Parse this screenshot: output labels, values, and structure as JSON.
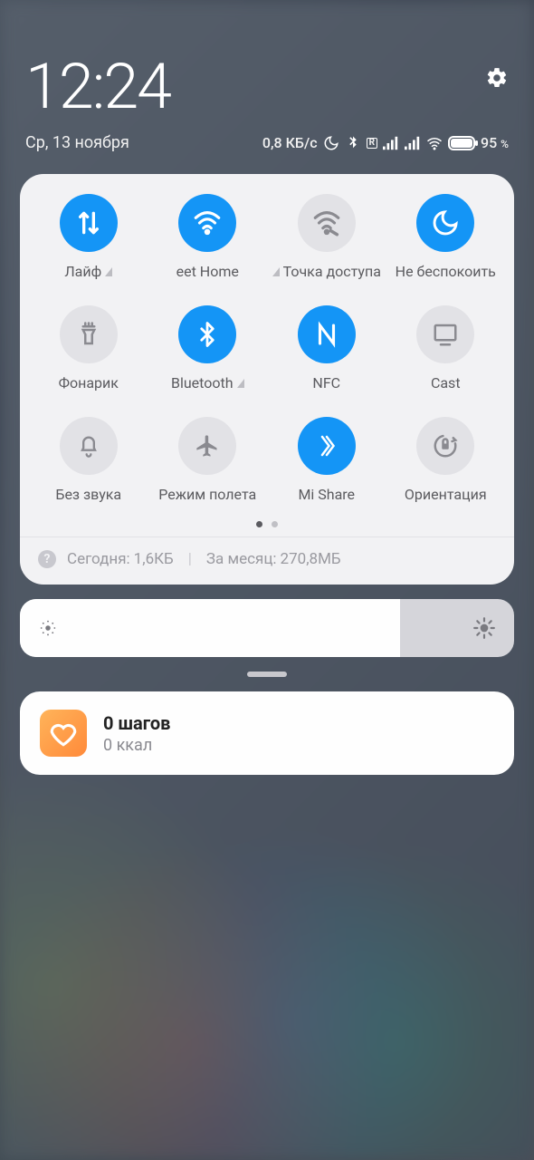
{
  "status": {
    "time": "12:24",
    "date": "Ср, 13 ноября",
    "data_rate": "0,8 КБ/с",
    "battery_pct": "95",
    "battery_suffix": "%"
  },
  "tiles": [
    {
      "label": "Лайф",
      "arrow": true
    },
    {
      "label": "eet Home",
      "arrow": false
    },
    {
      "label": "Точка доступа",
      "arrow": true,
      "arrow_before": true
    },
    {
      "label": "Не беспокоить",
      "arrow": false
    },
    {
      "label": "Фонарик",
      "arrow": false
    },
    {
      "label": "Bluetooth",
      "arrow": true
    },
    {
      "label": "NFC",
      "arrow": false
    },
    {
      "label": "Cast",
      "arrow": false
    },
    {
      "label": "Без звука",
      "arrow": false
    },
    {
      "label": "Режим полета",
      "arrow": false
    },
    {
      "label": "Mi Share",
      "arrow": false
    },
    {
      "label": "Ориентация",
      "arrow": false
    }
  ],
  "data_usage": {
    "today_label": "Сегодня:",
    "today_value": "1,6КБ",
    "month_label": "За месяц:",
    "month_value": "270,8МБ"
  },
  "notification": {
    "title": "0 шагов",
    "subtitle": "0 ккал"
  }
}
